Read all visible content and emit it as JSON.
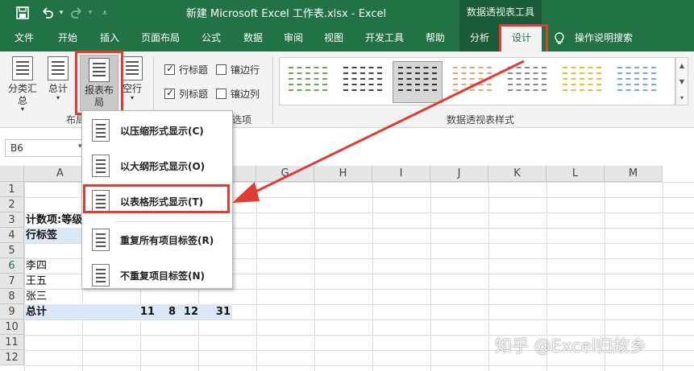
{
  "title_bar": {
    "title": "新建 Microsoft Excel 工作表.xlsx  -  Excel",
    "context_tools": "数据透视表工具"
  },
  "tabs": [
    "文件",
    "开始",
    "插入",
    "页面布局",
    "公式",
    "数据",
    "审阅",
    "视图",
    "开发工具",
    "帮助",
    "分析",
    "设计"
  ],
  "tell_me": "操作说明搜索",
  "ribbon": {
    "subtotals": "分类汇\n总",
    "grand_totals": "总计",
    "report_layout": "报表布\n局",
    "blank_rows": "空行",
    "layout_group": "布局",
    "row_headers": "行标题",
    "banded_rows": "镶边行",
    "col_headers": "列标题",
    "banded_cols": "镶边列",
    "style_options_group": "样式选项",
    "styles_group": "数据透视表样式"
  },
  "formula_bar": {
    "name_box": "B6"
  },
  "columns": [
    "A",
    "B",
    "C",
    "D",
    "E",
    "F",
    "G",
    "H",
    "I",
    "J",
    "K",
    "L",
    "M"
  ],
  "rows": [
    "1",
    "2",
    "3",
    "4",
    "5",
    "6",
    "7",
    "8",
    "9",
    "10",
    "11",
    "12"
  ],
  "cells": {
    "a3": "计数项:等级",
    "a4": "行标签",
    "a5": "李四",
    "a6": "王五",
    "a7": "张三",
    "a8": "总计",
    "b8": "11",
    "c8": "8",
    "d8": "12",
    "e8": "31"
  },
  "menu": {
    "items": [
      "以压缩形式显示(C)",
      "以大纲形式显示(O)",
      "以表格形式显示(T)",
      "重复所有项目标签(R)",
      "不重复项目标签(N)"
    ]
  },
  "watermark": "知乎 @Excel归故乡",
  "colors": {
    "excel_green": "#217346",
    "highlight_red": "#e03c31"
  }
}
